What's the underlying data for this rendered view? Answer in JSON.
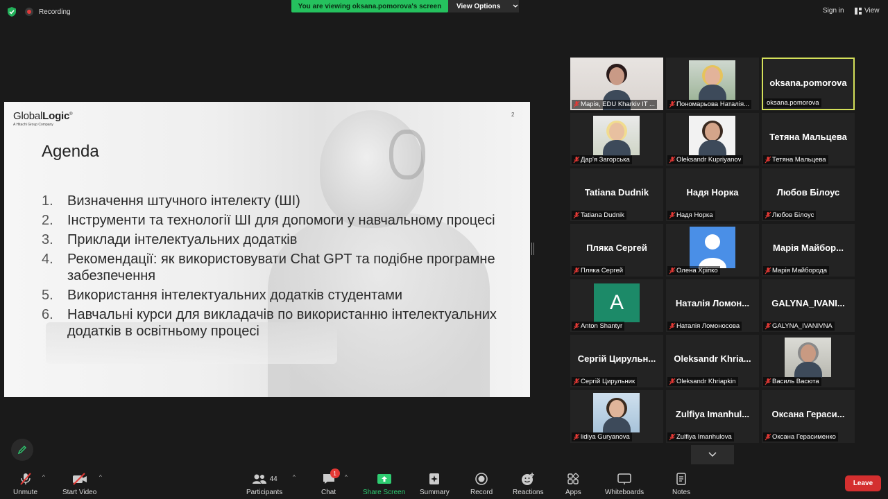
{
  "top_bar": {
    "recording": "Recording",
    "viewing_banner": "You are viewing oksana.pomorova's screen",
    "view_options": "View Options",
    "sign_in": "Sign in",
    "view": "View"
  },
  "slide": {
    "logo_part1": "Global",
    "logo_part2": "Logic",
    "logo_trademark": "®",
    "logo_sub": "A Hitachi Group Company",
    "page_number": "2",
    "title": "Agenda",
    "items": [
      {
        "num": "1.",
        "text": "Визначення штучного інтелекту (ШІ)"
      },
      {
        "num": "2.",
        "text": "Інструменти та технології ШІ для допомоги у навчальному процесі"
      },
      {
        "num": "3.",
        "text": "Приклади інтелектуальних додатків"
      },
      {
        "num": "4.",
        "text": "Рекомендації: як використовувати Chat GPT та подібне програмне забезпечення"
      },
      {
        "num": "5.",
        "text": "Використання інтелектуальних додатків студентами"
      },
      {
        "num": "6.",
        "text": "Навчальні курси для викладачів по використанню інтелектуальних додатків в освітньому процесі"
      }
    ]
  },
  "participants": [
    {
      "label": "Марія, EDU Kharkiv IT ...",
      "display": "",
      "type": "photo",
      "muted": true
    },
    {
      "label": "Пономарьова Наталія...",
      "display": "",
      "type": "photo",
      "muted": true
    },
    {
      "label": "oksana.pomorova",
      "display": "oksana.pomorova",
      "type": "name",
      "muted": false,
      "active": true
    },
    {
      "label": "Дар'я Загорська",
      "display": "",
      "type": "photo",
      "muted": true
    },
    {
      "label": "Oleksandr Kupriyanov",
      "display": "",
      "type": "photo",
      "muted": true
    },
    {
      "label": "Тетяна Мальцева",
      "display": "Тетяна Мальцева",
      "type": "name",
      "muted": true
    },
    {
      "label": "Tatiana Dudnik",
      "display": "Tatiana Dudnik",
      "type": "name",
      "muted": true
    },
    {
      "label": "Надя Норка",
      "display": "Надя Норка",
      "type": "name",
      "muted": true
    },
    {
      "label": "Любов Білоус",
      "display": "Любов Білоус",
      "type": "name",
      "muted": true
    },
    {
      "label": "Пляка Сергей",
      "display": "Пляка Сергей",
      "type": "name",
      "muted": true
    },
    {
      "label": "Олена Хріпко",
      "display": "",
      "type": "avatar",
      "muted": true
    },
    {
      "label": "Марія Майборода",
      "display": "Марія Майбор...",
      "type": "name",
      "muted": true
    },
    {
      "label": "Anton Shantyr",
      "display": "A",
      "type": "letter",
      "muted": true
    },
    {
      "label": "Наталія Ломоносова",
      "display": "Наталія Ломон...",
      "type": "name",
      "muted": true
    },
    {
      "label": "GALYNA_IVANIVNA",
      "display": "GALYNA_IVANI...",
      "type": "name",
      "muted": true
    },
    {
      "label": "Сергій Цирульник",
      "display": "Сергій Цирульн...",
      "type": "name",
      "muted": true
    },
    {
      "label": "Oleksandr Khriapkin",
      "display": "Oleksandr Khria...",
      "type": "name",
      "muted": true
    },
    {
      "label": "Василь Васюта",
      "display": "",
      "type": "photo",
      "muted": true
    },
    {
      "label": "lidiya Guryanova",
      "display": "",
      "type": "photo",
      "muted": true
    },
    {
      "label": "Zulfiya Imanhulova",
      "display": "Zulfiya Imanhul...",
      "type": "name",
      "muted": true
    },
    {
      "label": "Оксана Герасименко",
      "display": "Оксана Гераси...",
      "type": "name",
      "muted": true
    }
  ],
  "toolbar": {
    "unmute": "Unmute",
    "start_video": "Start Video",
    "participants": "Participants",
    "participants_count": "44",
    "chat": "Chat",
    "chat_badge": "1",
    "share_screen": "Share Screen",
    "summary": "Summary",
    "record": "Record",
    "reactions": "Reactions",
    "apps": "Apps",
    "whiteboards": "Whiteboards",
    "notes": "Notes",
    "leave": "Leave"
  },
  "colors": {
    "share_green": "#25c15e",
    "active_speaker": "#d4e05a",
    "leave_red": "#d42f2f",
    "muted_red": "#e53935"
  }
}
